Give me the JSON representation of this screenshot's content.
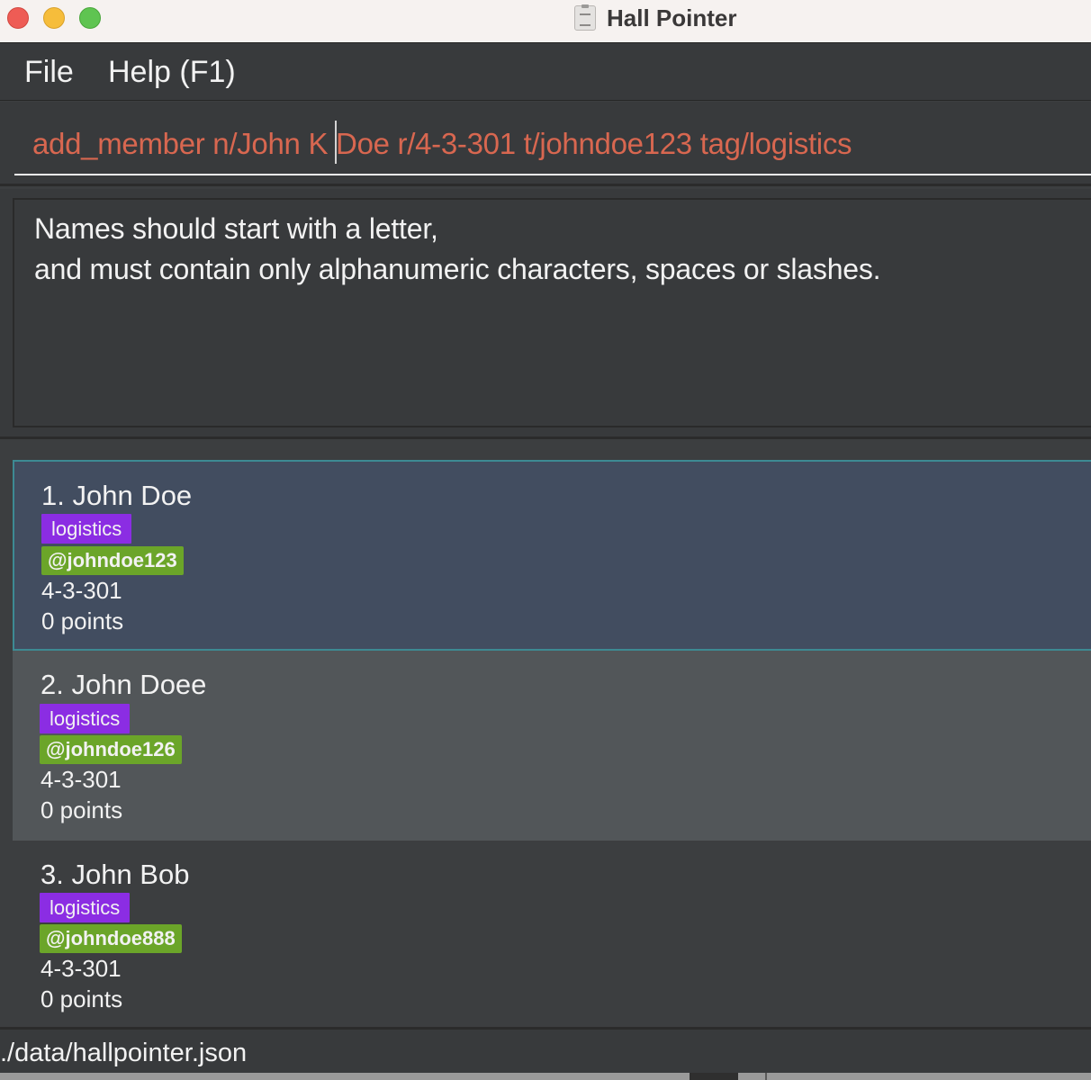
{
  "window": {
    "title": "Hall Pointer"
  },
  "menu": {
    "file": "File",
    "help": "Help (F1)"
  },
  "command": {
    "value": "add_member n/John K Doe r/4-3-301 t/johndoe123 tag/logistics"
  },
  "result": {
    "line1": "Names should start with a letter,",
    "line2": "and must contain only alphanumeric characters, spaces or slashes."
  },
  "members": [
    {
      "name": "1. John Doe",
      "tag": "logistics",
      "handle": "@johndoe123",
      "room": "4-3-301",
      "points": "0 points"
    },
    {
      "name": "2. John Doee",
      "tag": "logistics",
      "handle": "@johndoe126",
      "room": "4-3-301",
      "points": "0 points"
    },
    {
      "name": "3. John Bob",
      "tag": "logistics",
      "handle": "@johndoe888",
      "room": "4-3-301",
      "points": "0 points"
    }
  ],
  "status": {
    "path": "./data/hallpointer.json"
  },
  "colors": {
    "command_text": "#d86750",
    "tag_bg": "#8b2de3",
    "handle_bg": "#6ba529",
    "selected_card_bg": "#424d60",
    "selected_border": "#3d8a93"
  }
}
